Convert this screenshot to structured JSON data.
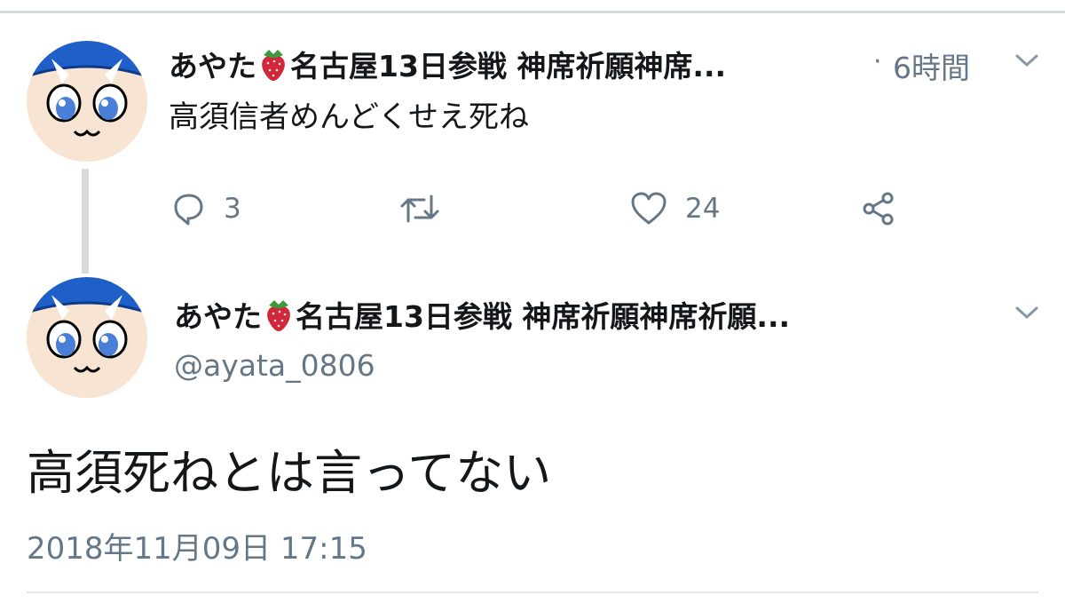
{
  "parent_tweet": {
    "display_name_before": "あやた",
    "display_name_after": "名古屋13日参戦  神席祈願神席...",
    "separator": "·",
    "time": "6時間",
    "text": "高須信者めんどくせえ死ね",
    "reply_count": "3",
    "retweet_count": "",
    "like_count": "24"
  },
  "main_tweet": {
    "display_name_before": "あやた",
    "display_name_after": "名古屋13日参戦  神席祈願神席祈願...",
    "handle": "@ayata_0806",
    "text": "高須死ねとは言ってない",
    "timestamp": "2018年11月09日 17:15"
  },
  "icons": {
    "emoji": "strawberry-icon",
    "menu": "chevron-down-icon",
    "reply": "reply-icon",
    "retweet": "retweet-icon",
    "like": "heart-icon",
    "share": "share-icon"
  },
  "colors": {
    "text": "#14171a",
    "secondary": "#657786",
    "divider": "#d6dbe0",
    "avatar_hat": "#1f5fc8",
    "avatar_skin": "#f7e4d3",
    "strawberry": "#d0283a"
  }
}
